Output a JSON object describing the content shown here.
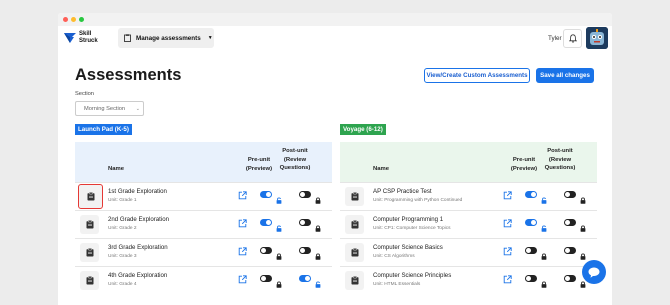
{
  "header": {
    "logo_text_line1": "Skill",
    "logo_text_line2": "Struck",
    "manage_label": "Manage assessments",
    "user_name": "Tyler"
  },
  "page": {
    "title": "Assessments",
    "custom_button": "View/Create Custom Assessments",
    "save_button": "Save all changes",
    "section_label": "Section",
    "section_value": "Morning Section"
  },
  "columns": {
    "name": "Name",
    "pre_line1": "Pre-unit",
    "pre_line2": "(Preview)",
    "post_line1": "Post-unit",
    "post_line2": "(Review",
    "post_line3": "Questions)"
  },
  "groups": [
    {
      "label": "Launch Pad (K-5)",
      "color": "#1a73e8",
      "rows": [
        {
          "title": "1st Grade Exploration",
          "unit": "Unit: Grade 1",
          "pre_on": true,
          "pre_locked": false,
          "post_on": false,
          "post_locked": true,
          "highlight": true
        },
        {
          "title": "2nd Grade Exploration",
          "unit": "Unit: Grade 2",
          "pre_on": true,
          "pre_locked": false,
          "post_on": false,
          "post_locked": true,
          "highlight": false
        },
        {
          "title": "3rd Grade Exploration",
          "unit": "Unit: Grade 3",
          "pre_on": false,
          "pre_locked": true,
          "post_on": false,
          "post_locked": true,
          "highlight": false
        },
        {
          "title": "4th Grade Exploration",
          "unit": "Unit: Grade 4",
          "pre_on": false,
          "pre_locked": true,
          "post_on": true,
          "post_locked": false,
          "highlight": false
        }
      ]
    },
    {
      "label": "Voyage (6-12)",
      "color": "#2ea44f",
      "rows": [
        {
          "title": "AP CSP Practice Test",
          "unit": "Unit: Programming with Python Continued",
          "pre_on": true,
          "pre_locked": false,
          "post_on": false,
          "post_locked": true,
          "highlight": false
        },
        {
          "title": "Computer Programming 1",
          "unit": "Unit: CP1: Computer Science Topics",
          "pre_on": true,
          "pre_locked": false,
          "post_on": false,
          "post_locked": true,
          "highlight": false
        },
        {
          "title": "Computer Science Basics",
          "unit": "Unit: CS Algorithms",
          "pre_on": false,
          "pre_locked": true,
          "post_on": false,
          "post_locked": true,
          "highlight": false
        },
        {
          "title": "Computer Science Principles",
          "unit": "Unit: HTML Essentials",
          "pre_on": false,
          "pre_locked": true,
          "post_on": false,
          "post_locked": true,
          "highlight": false
        }
      ]
    }
  ],
  "colors": {
    "accent": "#1a73e8",
    "toggle_off": "#222222",
    "panel_blue": "#e8f1fc",
    "panel_green": "#eaf6ec"
  }
}
